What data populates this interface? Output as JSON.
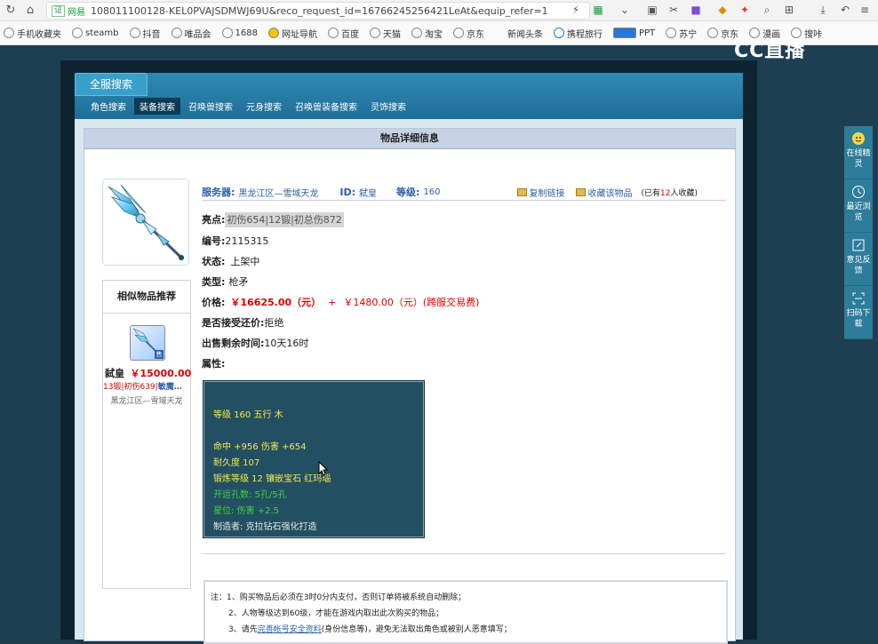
{
  "browser": {
    "site_badge": "证",
    "site_name": "网易",
    "url": "108011100128-KEL0PVAJSDMWJ69U&reco_request_id=1676624525642​1LeAt&equip_refer=1"
  },
  "bookmarks": [
    {
      "label": "手机收藏夹"
    },
    {
      "label": "steamb"
    },
    {
      "label": "抖音"
    },
    {
      "label": "唯品会"
    },
    {
      "label": "1688"
    },
    {
      "label": "网址导航"
    },
    {
      "label": "百度"
    },
    {
      "label": "天猫"
    },
    {
      "label": "淘宝"
    },
    {
      "label": "京东"
    },
    {
      "label": "新闻头条"
    },
    {
      "label": "携程旅行"
    },
    {
      "label": "PPT"
    },
    {
      "label": "苏宁"
    },
    {
      "label": "京东"
    },
    {
      "label": "漫画"
    },
    {
      "label": "搜咔"
    }
  ],
  "logo": "CC直播",
  "tabs": {
    "main": "全服搜索",
    "sub": [
      "角色搜索",
      "装备搜索",
      "召唤兽搜索",
      "元身搜索",
      "召唤兽装备搜索",
      "灵饰搜索"
    ],
    "active_index": 1
  },
  "detail": {
    "header": "物品详细信息",
    "server_label": "服务器:",
    "server_value": "黑龙江区—雪域天龙",
    "id_label": "ID:",
    "id_value": "弑皇",
    "level_label": "等级:",
    "level_value": "160",
    "copy_link": "复制链接",
    "favorite": "收藏该物品",
    "fav_count_prefix": "(已有",
    "fav_count": "12",
    "fav_count_suffix": "人收藏)",
    "highlight_label": "亮点:",
    "highlight_value": "初伤654|12锻|初总伤872",
    "number_label": "编号:",
    "number_value": "2115315",
    "status_label": "状态:",
    "status_value": "上架中",
    "type_label": "类型:",
    "type_value": "枪矛",
    "price_label": "价格:",
    "price_value": "￥16625.00（元）",
    "price_plus": "+",
    "fee_value": "￥1480.00（元）(跨服交易费)",
    "bargain_label": "是否接受还价:",
    "bargain_value": "拒绝",
    "remaining_label": "出售剩余时间:",
    "remaining_value": "10天16时",
    "attr_label": "属性:"
  },
  "stats": {
    "level_line": "等级 160 五行 木",
    "hit_line": "命中 +956 伤害 +654",
    "durability_line": "耐久度 107",
    "forge_line": "锻炼等级 12 镶嵌宝石 红玛瑙",
    "holes_line": "开运孔数: 5孔/5孔",
    "star_line": "星位: 伤害 +2.5",
    "maker_line": "制造者: 克拉钻石强化打造"
  },
  "similar": {
    "title": "相似物品推荐",
    "thumb_badge": "售",
    "name": "弑皇",
    "price": "￥15000.00",
    "tags_red": "13锻|初伤639|",
    "tags_blue": "敏魔…",
    "server": "黑龙江区—雪域天龙"
  },
  "notice": {
    "line1": "注：1、购买物品后必须在3时0分内支付，否则订单将被系统自动删除；",
    "line2": "2、人物等级达到60级，才能在游戏内取出此次购买的物品；",
    "line3_prefix": "3、请先",
    "line3_link": "完善帐号安全资料",
    "line3_suffix": "(身份信息等)，避免无法取出角色或被别人恶意填写；"
  },
  "float_bar": [
    {
      "label": "在线精灵",
      "icon": "avatar-icon"
    },
    {
      "label": "最近浏览",
      "icon": "clock-icon"
    },
    {
      "label": "意见反馈",
      "icon": "edit-icon"
    },
    {
      "label": "扫码下载",
      "icon": "scan-icon"
    }
  ],
  "colors": {
    "tab_blue": "#2f8ab5",
    "price_red": "#e00000",
    "stat_yellow": "#f5e84e",
    "stat_green": "#3ed23e",
    "stats_bg": "#234f62"
  }
}
